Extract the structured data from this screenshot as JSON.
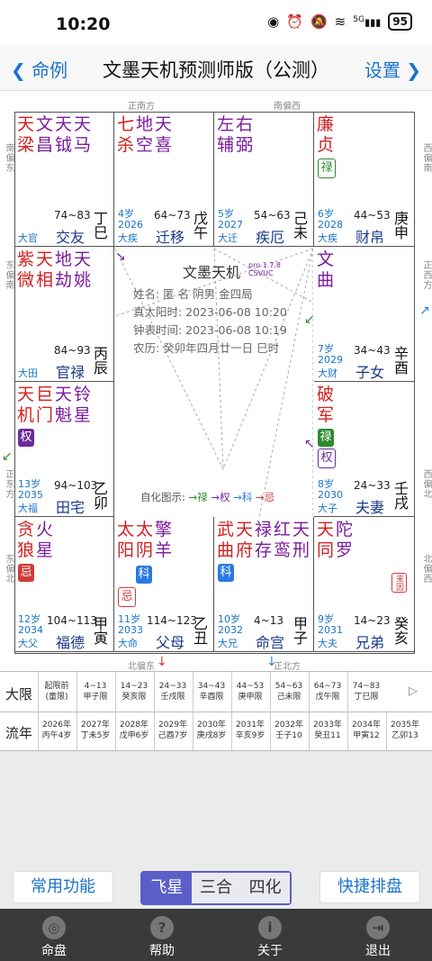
{
  "status": {
    "time": "10:20",
    "battery": "95",
    "signal_label": "5G"
  },
  "nav": {
    "back_label": "命例",
    "title": "文墨天机预测师版（公测）",
    "settings_label": "设置"
  },
  "directions": {
    "top_left": "正南方",
    "top_right": "南偏西",
    "left_1": "南偏东",
    "left_2": "东偏南",
    "left_3": "正东方",
    "left_4": "东偏北",
    "right_1": "西偏南",
    "right_2": "正西方",
    "right_3": "西偏北",
    "right_4": "北偏西",
    "bottom_left": "北偏东",
    "bottom_right": "正北方"
  },
  "palaces": [
    {
      "stars": [
        [
          "天",
          "梁"
        ],
        [
          "文",
          "昌"
        ],
        [
          "天",
          "钺"
        ],
        [
          "天",
          "马"
        ]
      ],
      "colors": [
        "red",
        "purple",
        "purple",
        "purple"
      ],
      "hua": [],
      "age": "",
      "year": "",
      "range": "74~83",
      "name": "交友",
      "ls": "大官",
      "stem": "丁巳"
    },
    {
      "stars": [
        [
          "七",
          "杀"
        ],
        [
          "地",
          "空"
        ],
        [
          "天",
          "喜"
        ]
      ],
      "colors": [
        "red",
        "purple",
        "purple"
      ],
      "hua": [],
      "age": "4岁",
      "year": "2026",
      "range": "64~73",
      "name": "迁移",
      "ls": "大疾",
      "stem": "戊午"
    },
    {
      "stars": [
        [
          "左",
          "辅"
        ],
        [
          "右",
          "弼"
        ]
      ],
      "colors": [
        "purple",
        "purple"
      ],
      "hua": [],
      "age": "5岁",
      "year": "2027",
      "range": "54~63",
      "name": "疾厄",
      "ls": "大迁",
      "stem": "己未"
    },
    {
      "stars": [
        [
          "廉",
          "贞"
        ]
      ],
      "colors": [
        "red"
      ],
      "hua": [
        "禄"
      ],
      "age": "6岁",
      "year": "2028",
      "range": "44~53",
      "name": "财帛",
      "ls": "大疾",
      "stem": "庚申"
    },
    {
      "stars": [
        [
          "紫",
          "微"
        ],
        [
          "天",
          "相"
        ],
        [
          "地",
          "劫"
        ],
        [
          "天",
          "姚"
        ]
      ],
      "colors": [
        "red",
        "red",
        "purple",
        "purple"
      ],
      "hua": [],
      "age": "",
      "year": "",
      "range": "84~93",
      "name": "官禄",
      "ls": "大田",
      "stem": "丙辰"
    },
    {
      "stars": [
        [
          "文",
          "曲"
        ]
      ],
      "colors": [
        "purple"
      ],
      "hua": [],
      "age": "7岁",
      "year": "2029",
      "range": "34~43",
      "name": "子女",
      "ls": "大财",
      "stem": "辛酉"
    },
    {
      "stars": [
        [
          "天",
          "机"
        ],
        [
          "巨",
          "门"
        ],
        [
          "天",
          "魁"
        ],
        [
          "铃",
          "星"
        ]
      ],
      "colors": [
        "red",
        "red",
        "purple",
        "purple"
      ],
      "hua": [
        "权"
      ],
      "age": "13岁",
      "year": "2035",
      "range": "94~103",
      "name": "田宅",
      "ls": "大福",
      "stem": "乙卯"
    },
    {
      "stars": [
        [
          "破",
          "军"
        ]
      ],
      "colors": [
        "red"
      ],
      "hua": [
        "禄",
        "权"
      ],
      "age": "8岁",
      "year": "2030",
      "range": "24~33",
      "name": "夫妻",
      "ls": "大子",
      "stem": "壬戌"
    },
    {
      "stars": [
        [
          "贪",
          "狼"
        ],
        [
          "火",
          "星"
        ]
      ],
      "colors": [
        "red",
        "purple"
      ],
      "hua": [
        "忌"
      ],
      "age": "12岁",
      "year": "2034",
      "range": "104~113",
      "name": "福德",
      "ls": "大父",
      "stem": "甲寅"
    },
    {
      "stars": [
        [
          "太",
          "阳"
        ],
        [
          "太",
          "阴"
        ],
        [
          "擎",
          "羊"
        ]
      ],
      "colors": [
        "red",
        "red",
        "purple"
      ],
      "hua": [
        "科",
        "忌"
      ],
      "age": "11岁",
      "year": "2033",
      "range": "114~123",
      "name": "父母",
      "ls": "大命",
      "stem": "乙丑"
    },
    {
      "stars": [
        [
          "武",
          "曲"
        ],
        [
          "天",
          "府"
        ],
        [
          "禄",
          "存"
        ],
        [
          "红",
          "鸾"
        ],
        [
          "天",
          "刑"
        ]
      ],
      "colors": [
        "red",
        "red",
        "purple",
        "purple",
        "purple"
      ],
      "hua": [
        "科"
      ],
      "age": "10岁",
      "year": "2032",
      "range": "4~13",
      "name": "命宫",
      "ls": "大兄",
      "stem": "甲子"
    },
    {
      "stars": [
        [
          "天",
          "同"
        ],
        [
          "陀",
          "罗"
        ]
      ],
      "colors": [
        "red",
        "purple"
      ],
      "hua": [],
      "age": "9岁",
      "year": "2031",
      "range": "14~23",
      "name": "兄弟",
      "ls": "大夫",
      "stem": "癸亥",
      "laiyin": "来因"
    }
  ],
  "center": {
    "title": "文墨天机",
    "version": "pro 1.7.8",
    "code": "CSVUC",
    "line1": "姓名: 匿 名       阴男 金四局",
    "line2": "真太阳时: 2023-06-08 10:20",
    "line3": "钟表时间: 2023-06-08 10:19",
    "line4": "农历: 癸卯年四月廿一日 巳时",
    "sihua_label": "自化图示:",
    "sihua_lu": "→禄",
    "sihua_quan": "→权",
    "sihua_ke": "→科",
    "sihua_ji": "→忌"
  },
  "daxian": {
    "label": "大限",
    "cells": [
      [
        "起限前",
        "(童限)"
      ],
      [
        "4~13",
        "甲子限"
      ],
      [
        "14~23",
        "癸亥限"
      ],
      [
        "24~33",
        "壬戌限"
      ],
      [
        "34~43",
        "辛酉限"
      ],
      [
        "44~53",
        "庚申限"
      ],
      [
        "54~63",
        "己未限"
      ],
      [
        "64~73",
        "戊午限"
      ],
      [
        "74~83",
        "丁巳限"
      ]
    ],
    "more": "▷"
  },
  "liunian": {
    "label": "流年",
    "cells": [
      [
        "2026年",
        "丙午4岁"
      ],
      [
        "2027年",
        "丁未5岁"
      ],
      [
        "2028年",
        "戊申6岁"
      ],
      [
        "2029年",
        "己酉7岁"
      ],
      [
        "2030年",
        "庚戌8岁"
      ],
      [
        "2031年",
        "辛亥9岁"
      ],
      [
        "2032年",
        "壬子10"
      ],
      [
        "2033年",
        "癸丑11"
      ],
      [
        "2034年",
        "甲寅12"
      ],
      [
        "2035年",
        "乙卯13"
      ]
    ]
  },
  "buttons": {
    "common": "常用功能",
    "seg_feixing": "飞星",
    "seg_sanhe": "三合",
    "seg_sihua": "四化",
    "quick": "快捷排盘"
  },
  "tabs": {
    "mingpan": "命盘",
    "help": "帮助",
    "about": "关于",
    "exit": "退出"
  }
}
